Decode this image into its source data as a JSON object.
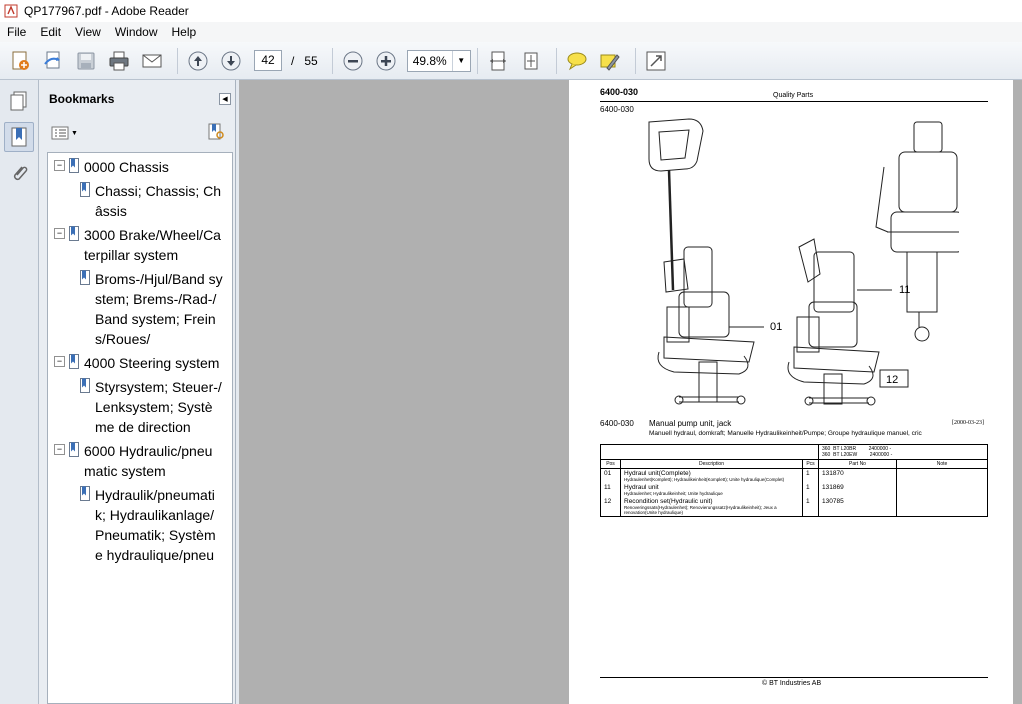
{
  "window": {
    "title": "QP177967.pdf - Adobe Reader"
  },
  "menubar": {
    "items": [
      "File",
      "Edit",
      "View",
      "Window",
      "Help"
    ]
  },
  "toolbar": {
    "page_current": "42",
    "page_sep": "/",
    "page_total": "55",
    "zoom": "49.8%",
    "icons": [
      "create-pdf-icon",
      "share-icon",
      "save-icon",
      "print-icon",
      "email-icon",
      "prev-page-icon",
      "next-page-icon",
      "zoom-out-icon",
      "zoom-in-icon",
      "fit-width-icon",
      "fit-page-icon",
      "comment-icon",
      "sign-icon",
      "fullscreen-icon"
    ]
  },
  "bookmarks": {
    "title": "Bookmarks",
    "items": [
      {
        "label": "0000 Chassis",
        "expanded": "⊟",
        "children": [
          "Chassi; Chassis; Châssis"
        ]
      },
      {
        "label": "3000 Brake/Wheel/Caterpillar system",
        "expanded": "⊟",
        "children": [
          "Broms-/Hjul/Band system; Brems-/Rad-/Band system; Freins/Roues/"
        ]
      },
      {
        "label": "4000 Steering system",
        "expanded": "⊟",
        "children": [
          "Styrsystem; Steuer-/Lenksystem; Système de direction"
        ]
      },
      {
        "label": "6000 Hydraulic/pneumatic system",
        "expanded": "⊟",
        "children": [
          "Hydraulik/pneumatik; Hydraulikanlage/Pneumatik; Système hydraulique/pneu"
        ]
      }
    ]
  },
  "document": {
    "header_code": "6400-030",
    "header_center": "Quality Parts",
    "sub_code": "6400-030",
    "callouts": [
      "01",
      "11",
      "12"
    ],
    "caption_code": "6400-030",
    "caption_title": "Manual pump unit, jack",
    "caption_date": "[2000-03-23]",
    "caption_sub": "Manuell hydraul, domkraft; Manuelle Hydraulikeinheit/Pumpe; Groupe hydraulique manuel, cric",
    "models": [
      {
        "a": "360",
        "b": "BT L20BR",
        "c": "2400000 -"
      },
      {
        "a": "360",
        "b": "BT L20EW",
        "c": "2400000 -"
      }
    ],
    "table_headers": [
      "Pos",
      "Description",
      "Pcs",
      "Part No",
      "Note"
    ],
    "rows": [
      {
        "pos": "01",
        "desc": "Hydraul unit(Complete)",
        "sub": "Hydraulenhet(Komplett); Hydraulikeinheit(Komplett); Unite hydraulique(Complet)",
        "pcs": "1",
        "part": "131870",
        "note": ""
      },
      {
        "pos": "11",
        "desc": "Hydraul unit",
        "sub": "Hydraulenhet; Hydraulikeinheit; Unite hydraulique",
        "pcs": "1",
        "part": "131869",
        "note": ""
      },
      {
        "pos": "12",
        "desc": "Recondition set(Hydraulic unit)",
        "sub": "Renoveringssats(Hydraulenhet); Renovierungssatz(Hydraulikeinheit); Jeux a renovation(Unite hydraulique)",
        "pcs": "1",
        "part": "130785",
        "note": ""
      }
    ],
    "footer": "© BT Industries AB"
  }
}
